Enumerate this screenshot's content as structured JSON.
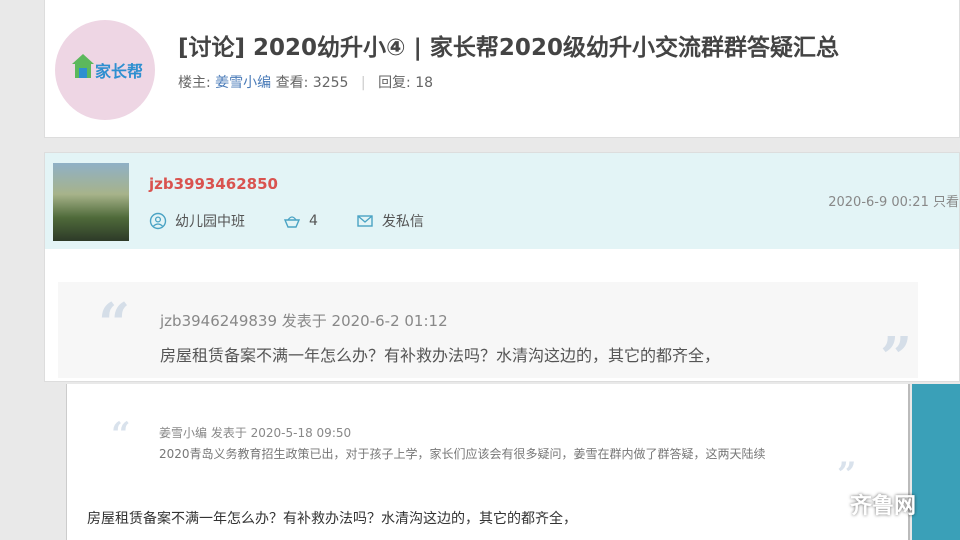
{
  "header": {
    "logo_text": "家长帮",
    "title": "[讨论] 2020幼升小④ | 家长帮2020级幼升小交流群群答疑汇总",
    "owner_label": "楼主:",
    "owner_name": "姜雪小编",
    "views_label": "查看:",
    "views": "3255",
    "replies_label": "回复:",
    "replies": "18"
  },
  "post": {
    "username": "jzb3993462850",
    "user_level": "幼儿园中班",
    "user_points": "4",
    "message_link": "发私信",
    "timestamp": "2020-6-9 00:21",
    "view_only_label": "只看",
    "quote": {
      "author_line": "jzb3946249839 发表于 2020-6-2 01:12",
      "text": "房屋租赁备案不满一年怎么办？有补救办法吗？水清沟这边的，其它的都齐全，"
    }
  },
  "inner": {
    "quote_meta": "姜雪小编 发表于 2020-5-18 09:50",
    "quote_text": "2020青岛义务教育招生政策已出，对于孩子上学，家长们应该会有很多疑问，姜雪在群内做了群答疑，这两天陆续",
    "reply_text": "房屋租赁备案不满一年怎么办？有补救办法吗？水清沟这边的，其它的都齐全，"
  },
  "watermark": {
    "text": "齐鲁网"
  },
  "colors": {
    "username": "#d9534f",
    "link": "#4a7bb8",
    "post_header_bg": "#e3f4f6",
    "logo_circle": "#eed6e4"
  }
}
